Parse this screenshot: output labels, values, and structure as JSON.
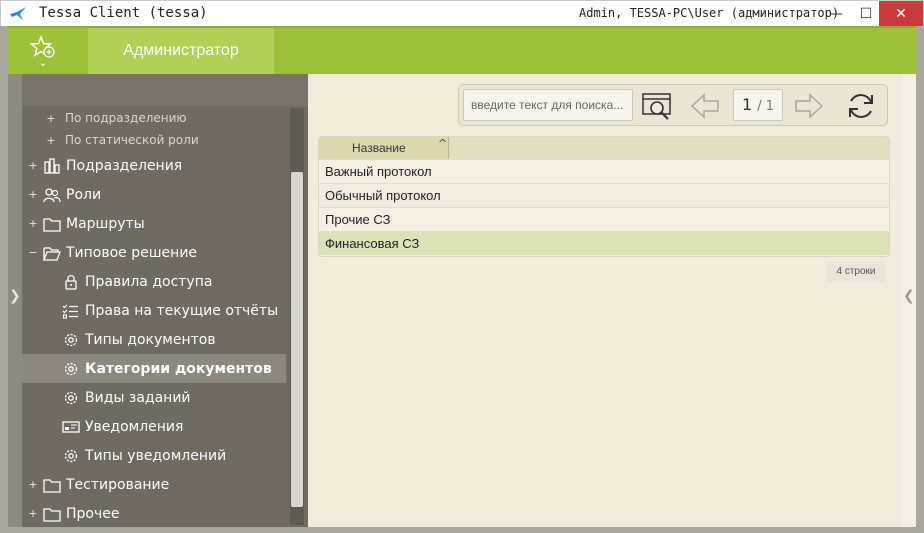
{
  "window": {
    "title": "Tessa Client (tessa)",
    "user": "Admin, TESSA-PC\\User (администратор)",
    "minimize": "—",
    "maximize": "☐",
    "close": "✕"
  },
  "topbar": {
    "favorites_icon": "star-add-icon",
    "favorites_chevron": "⌄",
    "active_tab": "Администратор"
  },
  "colors": {
    "accent_green": "#9ec13a",
    "sidebar_bg": "#6f6b61",
    "selected_row": "#dbe2b6"
  },
  "sidebar": {
    "nodes": [
      {
        "label": "По подразделению",
        "expander": "+",
        "icon": ""
      },
      {
        "label": "По статической роли",
        "expander": "+",
        "icon": ""
      },
      {
        "label": "Подразделения",
        "expander": "+",
        "icon": "org-chart-icon"
      },
      {
        "label": "Роли",
        "expander": "+",
        "icon": "users-icon"
      },
      {
        "label": "Маршруты",
        "expander": "+",
        "icon": "folder-icon"
      },
      {
        "label": "Типовое решение",
        "expander": "−",
        "icon": "folder-open-icon"
      },
      {
        "label": "Правила доступа",
        "expander": "",
        "icon": "lock-icon"
      },
      {
        "label": "Права на текущие отчёты",
        "expander": "",
        "icon": "checklist-icon"
      },
      {
        "label": "Типы документов",
        "expander": "",
        "icon": "gear-icon"
      },
      {
        "label": "Категории документов",
        "expander": "",
        "icon": "gear-icon"
      },
      {
        "label": "Виды заданий",
        "expander": "",
        "icon": "gear-icon"
      },
      {
        "label": "Уведомления",
        "expander": "",
        "icon": "notification-icon"
      },
      {
        "label": "Типы уведомлений",
        "expander": "",
        "icon": "gear-icon"
      },
      {
        "label": "Тестирование",
        "expander": "+",
        "icon": "folder-icon"
      },
      {
        "label": "Прочее",
        "expander": "+",
        "icon": "folder-icon"
      }
    ]
  },
  "toolbar": {
    "search_placeholder": "введите текст для поиска...",
    "page_current": "1",
    "page_total": "/ 1"
  },
  "grid": {
    "column": "Название",
    "sort_indicator": "^",
    "rows": [
      "Важный протокол",
      "Обычный протокол",
      "Прочие СЗ",
      "Финансовая СЗ"
    ],
    "selected_index": 3
  },
  "row_count": "4 строки"
}
